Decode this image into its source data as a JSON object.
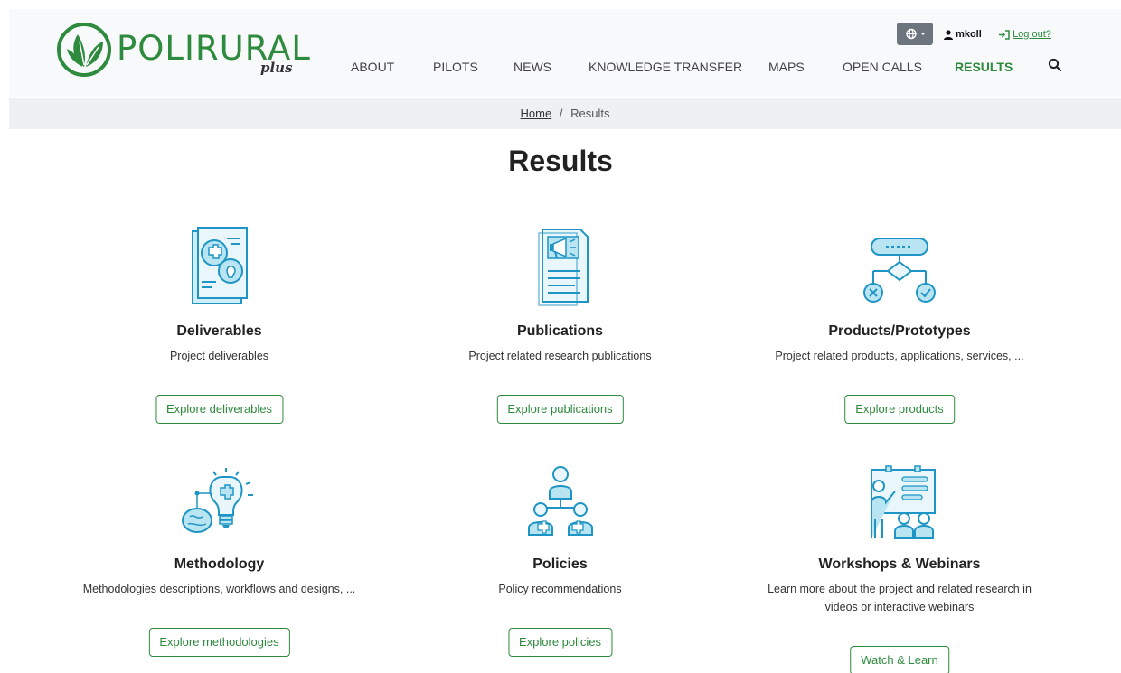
{
  "logo": {
    "text": "POLIRURAL",
    "suffix": "plus"
  },
  "nav": {
    "items": [
      {
        "label": "About"
      },
      {
        "label": "Pilots"
      },
      {
        "label": "News"
      },
      {
        "label": "Knowledge Transfer"
      },
      {
        "label": "Maps"
      },
      {
        "label": "Open Calls"
      },
      {
        "label": "Results",
        "active": true
      }
    ]
  },
  "user": {
    "name": "mkoll",
    "logout_label": "Log out?"
  },
  "breadcrumb": {
    "home": "Home",
    "separator": "/",
    "current": "Results"
  },
  "page": {
    "title": "Results"
  },
  "cards": [
    {
      "title": "Deliverables",
      "description": "Project deliverables",
      "button": "Explore deliverables",
      "icon": "document-puzzle-bulb-icon"
    },
    {
      "title": "Publications",
      "description": "Project related research publications",
      "button": "Explore publications",
      "icon": "megaphone-document-icon"
    },
    {
      "title": "Products/Prototypes",
      "description": "Project related products, applications, services, ...",
      "button": "Explore products",
      "icon": "flowchart-icon"
    },
    {
      "title": "Methodology",
      "description": "Methodologies descriptions, workflows and designs, ...",
      "button": "Explore methodologies",
      "icon": "brain-bulb-icon"
    },
    {
      "title": "Policies",
      "description": "Policy recommendations",
      "button": "Explore policies",
      "icon": "people-network-icon"
    },
    {
      "title": "Workshops & Webinars",
      "description": "Learn more about the project and related research in videos or interactive webinars",
      "button": "Watch & Learn",
      "icon": "presentation-audience-icon"
    }
  ],
  "colors": {
    "accent": "#2e8b3e",
    "icon_fill": "#b9e4f2",
    "icon_stroke": "#1e95c4",
    "header_bg": "#f8f9fa",
    "breadcrumb_bg": "#eef1f3"
  }
}
